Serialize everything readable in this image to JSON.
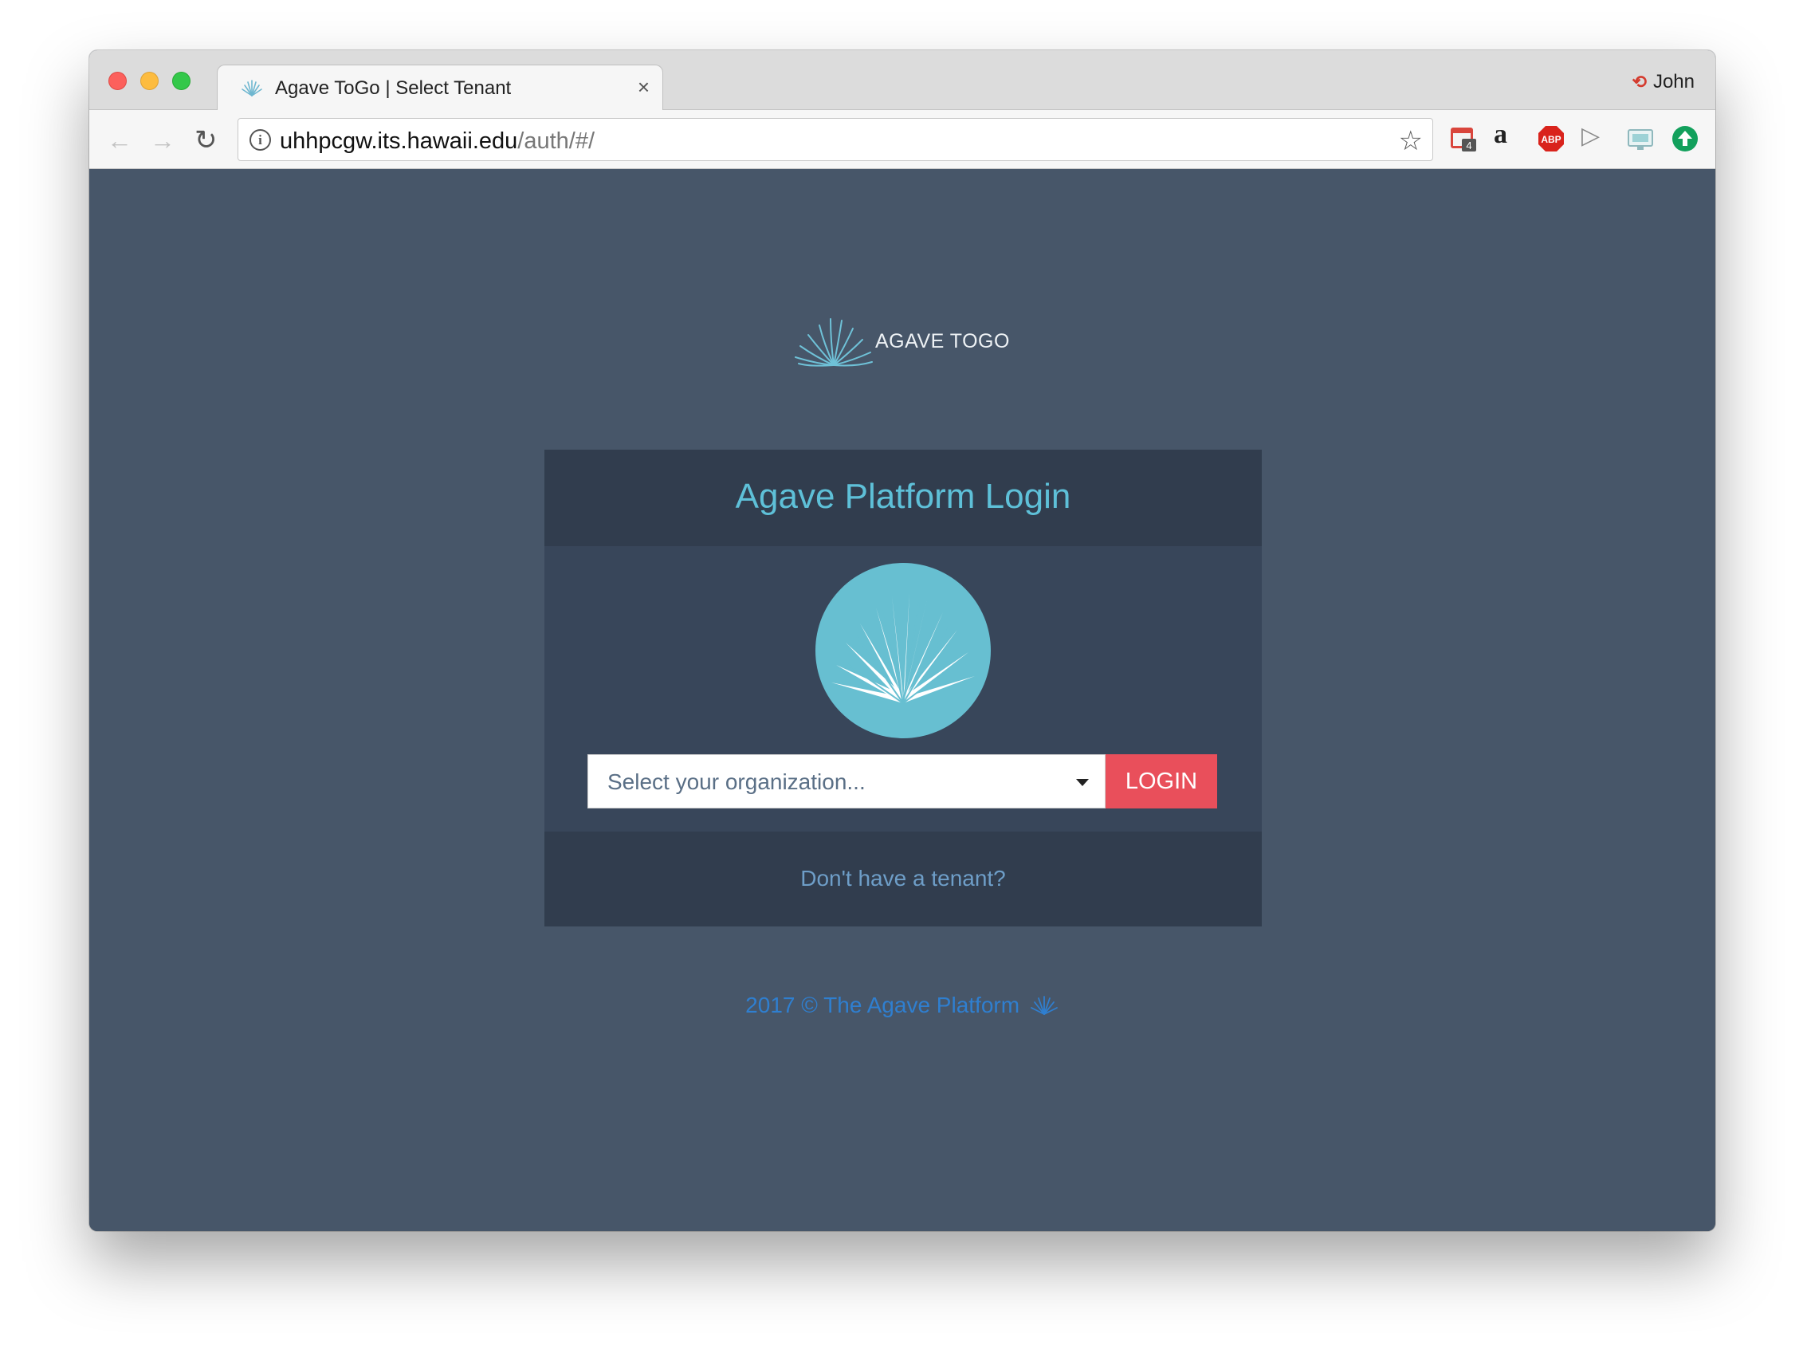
{
  "browser": {
    "tab_title": "Agave ToGo | Select Tenant",
    "tab_close": "×",
    "profile_name": "John",
    "url_host": "uhhpcgw.its.hawaii.edu",
    "url_path": "/auth/#/",
    "extensions": [
      "calendar-extension",
      "amazon-extension",
      "adblock-plus-extension",
      "play-extension",
      "monitor-extension",
      "upload-extension"
    ],
    "calendar_badge": "4",
    "abp_label": "ABP",
    "amazon_label": "a"
  },
  "page": {
    "brand_text": "AGAVE TOGO",
    "card_title": "Agave Platform Login",
    "select_placeholder": "Select your organization...",
    "login_label": "LOGIN",
    "tenant_link": "Don't have a tenant?",
    "footer_text": "2017 © The Agave Platform"
  },
  "colors": {
    "background": "#475669",
    "card_header": "#313d4e",
    "card_body": "#38465a",
    "accent_teal": "#5ec0d8",
    "login_red": "#e94f5b",
    "link_blue": "#6e9ec8",
    "footer_blue": "#2f7fd0"
  }
}
